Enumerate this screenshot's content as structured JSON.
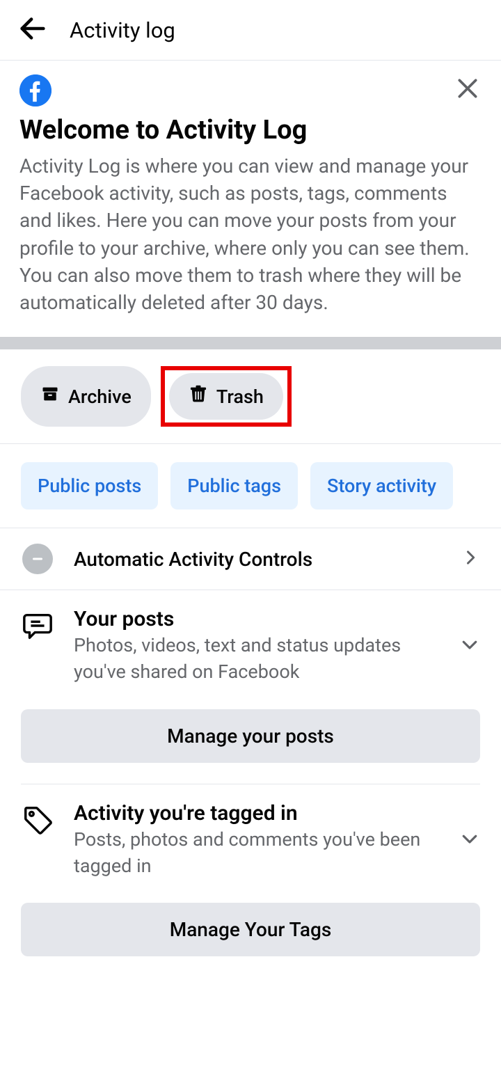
{
  "header": {
    "title": "Activity log"
  },
  "intro": {
    "title": "Welcome to Activity Log",
    "description": "Activity Log is where you can view and manage your Facebook activity, such as posts, tags, comments and likes. Here you can move your posts from your profile to your archive, where only you can see them. You can also move them to trash where they will be automatically deleted after 30 days."
  },
  "pills": {
    "archive": "Archive",
    "trash": "Trash"
  },
  "filters": {
    "public_posts": "Public posts",
    "public_tags": "Public tags",
    "story_activity": "Story activity"
  },
  "auto_controls": {
    "title": "Automatic Activity Controls"
  },
  "your_posts": {
    "title": "Your posts",
    "desc": "Photos, videos, text and status updates you've shared on Facebook",
    "button": "Manage your posts"
  },
  "tagged": {
    "title": "Activity you're tagged in",
    "desc": "Posts, photos and comments you've been tagged in",
    "button": "Manage Your Tags"
  }
}
